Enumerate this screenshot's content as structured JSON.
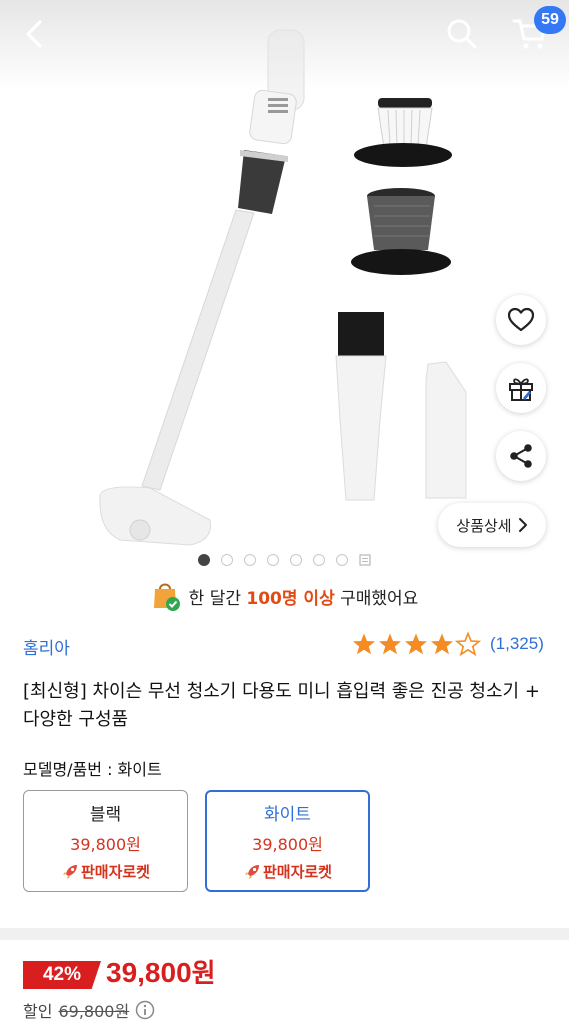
{
  "header": {
    "cart_count": "59"
  },
  "icons": {
    "back": "chevron-left-icon",
    "search": "search-icon",
    "cart": "cart-icon",
    "wishlist": "heart-icon",
    "gift": "gift-icon",
    "share": "share-icon"
  },
  "gallery": {
    "detail_label": "상품상세",
    "total_dots": 8,
    "active_index": 0
  },
  "banner": {
    "prefix": "한 달간 ",
    "highlight": "100명 이상",
    "suffix": " 구매했어요"
  },
  "product": {
    "brand": "홈리아",
    "rating": 4.5,
    "review_count": "(1,325)",
    "title": "[최신형] 차이슨 무선 청소기 다용도 미니 흡입력 좋은 진공 청소기 + 다양한 구성품"
  },
  "options": {
    "label": "모델명/품번 : 화이트",
    "items": [
      {
        "name": "블랙",
        "price": "39,800원",
        "badge": "판매자로켓",
        "selected": false
      },
      {
        "name": "화이트",
        "price": "39,800원",
        "badge": "판매자로켓",
        "selected": true
      }
    ]
  },
  "pricing": {
    "discount": "42%",
    "price": "39,800",
    "price_unit": "원",
    "discount_label": "할인",
    "original_price": "69,800원"
  },
  "colors": {
    "accent_blue": "#2f6fd6",
    "price_red": "#d81e1e",
    "banner_orange": "#e34b14",
    "star_orange": "#f58b23"
  }
}
